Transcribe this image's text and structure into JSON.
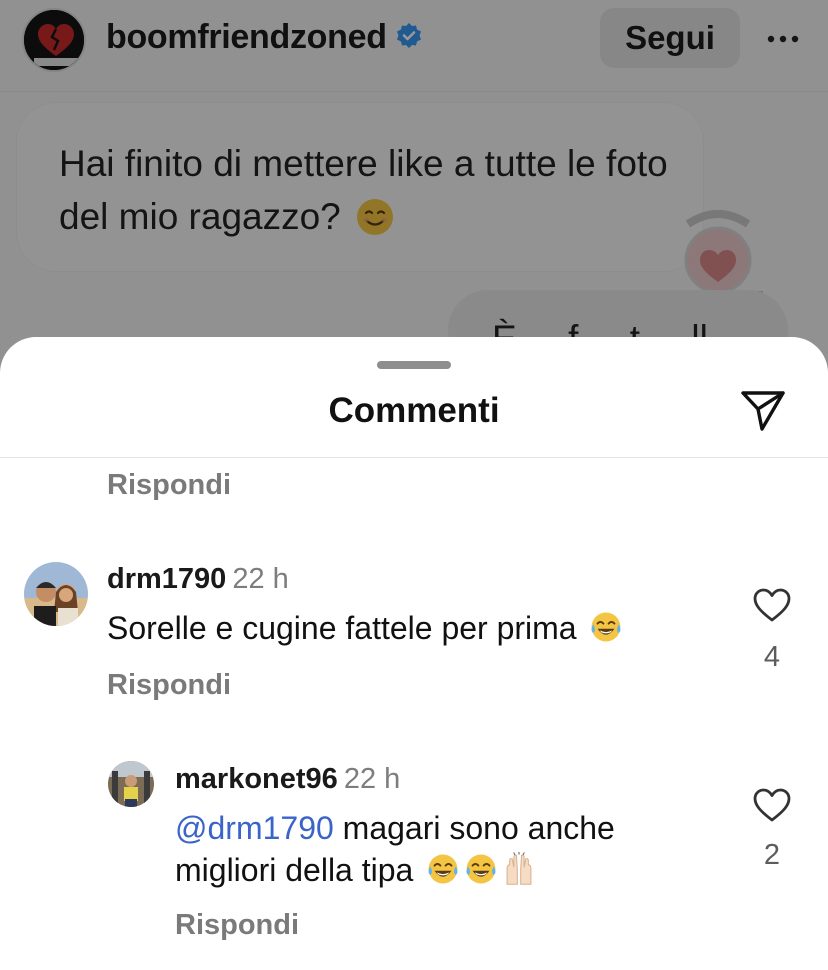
{
  "post": {
    "username": "boomfriendzoned",
    "follow_label": "Segui",
    "message_text": "Hai finito di mettere like a tutte le foto del mio ragazzo?",
    "message_emoji": "smiling-face-icon",
    "reply_preview_text": "È ... f ... t ... ll"
  },
  "sheet": {
    "title": "Commenti"
  },
  "comments": [
    {
      "reply_label": "Rispondi"
    },
    {
      "username": "drm1790",
      "time": "22 h",
      "text": "Sorelle e cugine fattele per prima",
      "emojis": [
        "tears-of-joy-icon"
      ],
      "likes": "4",
      "reply_label": "Rispondi"
    },
    {
      "username": "markonet96",
      "time": "22 h",
      "mention": "@drm1790",
      "text": " magari sono anche migliori della tipa",
      "emojis": [
        "tears-of-joy-icon",
        "tears-of-joy-icon",
        "raised-hands-icon"
      ],
      "likes": "2",
      "reply_label": "Rispondi"
    }
  ],
  "colors": {
    "mention": "#3a64c8",
    "muted": "#7a7a7a",
    "verified": "#3897f0"
  }
}
